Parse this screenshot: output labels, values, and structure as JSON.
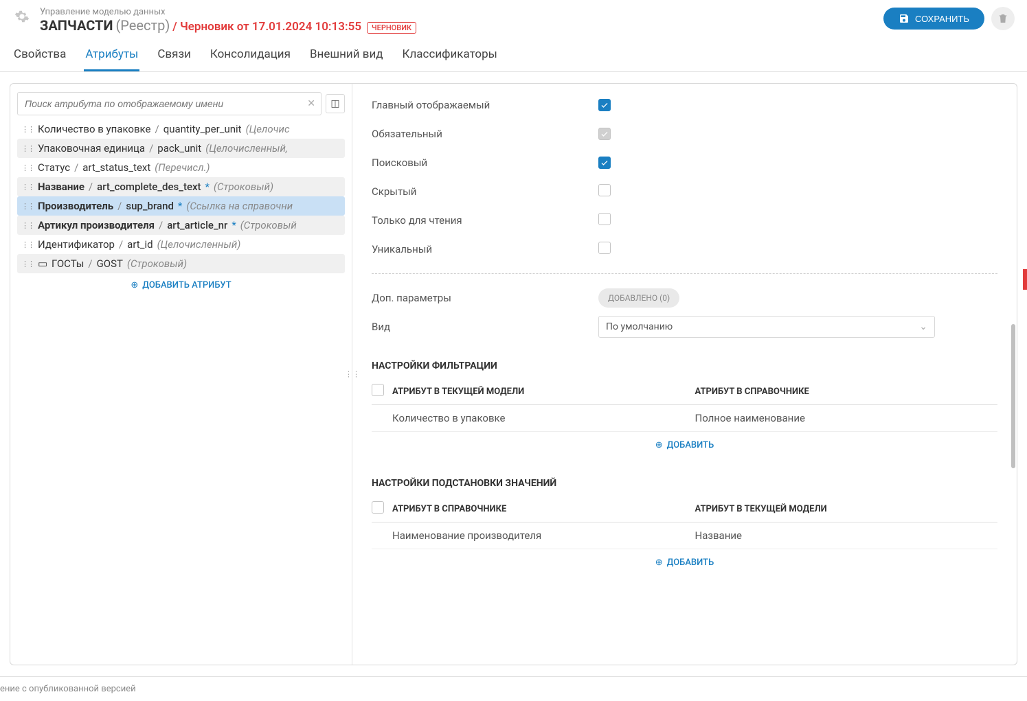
{
  "header": {
    "subtitle": "Управление моделью данных",
    "title_main": "ЗАПЧАСТИ",
    "title_paren": "(Реестр)",
    "title_draft": "/ Черновик от 17.01.2024 10:13:55",
    "title_badge": "ЧЕРНОВИК",
    "save_label": "СОХРАНИТЬ"
  },
  "tabs": [
    {
      "label": "Свойства",
      "active": false
    },
    {
      "label": "Атрибуты",
      "active": true
    },
    {
      "label": "Связи",
      "active": false
    },
    {
      "label": "Консолидация",
      "active": false
    },
    {
      "label": "Внешний вид",
      "active": false
    },
    {
      "label": "Классификаторы",
      "active": false
    }
  ],
  "search": {
    "placeholder": "Поиск атрибута по отображаемому имени"
  },
  "attrs": [
    {
      "name": "Количество в упаковке",
      "code": "quantity_per_unit",
      "type": "(Целочис",
      "bold": false,
      "star": false,
      "selected": false,
      "alt": false,
      "link": false
    },
    {
      "name": "Упаковочная единица",
      "code": "pack_unit",
      "type": "(Целочисленный,",
      "bold": false,
      "star": false,
      "selected": false,
      "alt": true,
      "link": false
    },
    {
      "name": "Статус",
      "code": "art_status_text",
      "type": "(Перечисл.)",
      "bold": false,
      "star": false,
      "selected": false,
      "alt": false,
      "link": false
    },
    {
      "name": "Название",
      "code": "art_complete_des_text",
      "type": "(Строковый)",
      "bold": true,
      "star": true,
      "selected": false,
      "alt": true,
      "link": false
    },
    {
      "name": "Производитель",
      "code": "sup_brand",
      "type": "(Ссылка на справочни",
      "bold": true,
      "star": true,
      "selected": true,
      "alt": false,
      "link": false
    },
    {
      "name": "Артикул производителя",
      "code": "art_article_nr",
      "type": "(Строковый",
      "bold": true,
      "star": true,
      "selected": false,
      "alt": true,
      "link": false
    },
    {
      "name": "Идентификатор",
      "code": "art_id",
      "type": "(Целочисленный)",
      "bold": false,
      "star": false,
      "selected": false,
      "alt": false,
      "link": false
    },
    {
      "name": "ГОСТы",
      "code": "GOST",
      "type": "(Строковый)",
      "bold": false,
      "star": false,
      "selected": false,
      "alt": true,
      "link": true
    }
  ],
  "add_attr_label": "ДОБАВИТЬ АТРИБУТ",
  "form": {
    "main_display": "Главный отображаемый",
    "required": "Обязательный",
    "searchable": "Поисковый",
    "hidden": "Скрытый",
    "readonly": "Только для чтения",
    "unique": "Уникальный",
    "extra_params": "Доп. параметры",
    "extra_pill": "ДОБАВЛЕНО (0)",
    "view": "Вид",
    "view_value": "По умолчанию"
  },
  "filter_section": {
    "title": "НАСТРОЙКИ ФИЛЬТРАЦИИ",
    "col1": "АТРИБУТ В ТЕКУЩЕЙ МОДЕЛИ",
    "col2": "АТРИБУТ В СПРАВОЧНИКЕ",
    "row": {
      "c1": "Количество в упаковке",
      "c2": "Полное наименование"
    },
    "add": "ДОБАВИТЬ"
  },
  "subst_section": {
    "title": "НАСТРОЙКИ ПОДСТАНОВКИ ЗНАЧЕНИЙ",
    "col1": "АТРИБУТ В СПРАВОЧНИКЕ",
    "col2": "АТРИБУТ В ТЕКУЩЕЙ МОДЕЛИ",
    "row": {
      "c1": "Наименование производителя",
      "c2": "Название"
    },
    "add": "ДОБАВИТЬ"
  },
  "footer": "ение с опубликованной версией"
}
